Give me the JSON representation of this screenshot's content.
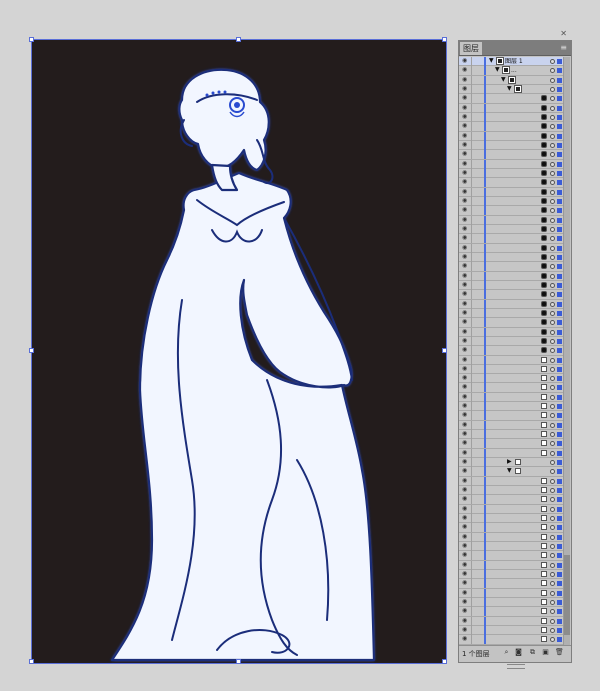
{
  "panel": {
    "tab_label": "图层",
    "menu_icon": "panel-menu-icon",
    "close_icon": "close-icon",
    "top_layer": {
      "name": "图层 1"
    },
    "footer": {
      "layer_count": "1 个图层"
    },
    "footer_icons": [
      "locate-object-icon",
      "make-clipping-mask-icon",
      "new-sublayer-icon",
      "new-layer-icon",
      "delete-icon"
    ],
    "rows": [
      {
        "kind": "layer",
        "indent": 0,
        "arrow": "▼",
        "label": "图层 1",
        "selected": true
      },
      {
        "kind": "group",
        "indent": 1,
        "arrow": "▼",
        "label": "..."
      },
      {
        "kind": "group",
        "indent": 2,
        "arrow": "▼",
        "label": ""
      },
      {
        "kind": "group",
        "indent": 3,
        "arrow": "▼",
        "label": ""
      },
      {
        "kind": "path",
        "indent": 4,
        "thumb": "dark"
      },
      {
        "kind": "path",
        "indent": 4,
        "thumb": "dark"
      },
      {
        "kind": "path",
        "indent": 4,
        "thumb": "dark"
      },
      {
        "kind": "path",
        "indent": 4,
        "thumb": "dark"
      },
      {
        "kind": "path",
        "indent": 4,
        "thumb": "dark"
      },
      {
        "kind": "path",
        "indent": 4,
        "thumb": "dark"
      },
      {
        "kind": "path",
        "indent": 4,
        "thumb": "dark"
      },
      {
        "kind": "path",
        "indent": 4,
        "thumb": "dark"
      },
      {
        "kind": "path",
        "indent": 4,
        "thumb": "dark"
      },
      {
        "kind": "path",
        "indent": 4,
        "thumb": "dark"
      },
      {
        "kind": "path",
        "indent": 4,
        "thumb": "dark"
      },
      {
        "kind": "path",
        "indent": 4,
        "thumb": "dark"
      },
      {
        "kind": "path",
        "indent": 4,
        "thumb": "dark"
      },
      {
        "kind": "path",
        "indent": 4,
        "thumb": "dark"
      },
      {
        "kind": "path",
        "indent": 4,
        "thumb": "dark"
      },
      {
        "kind": "path",
        "indent": 4,
        "thumb": "dark"
      },
      {
        "kind": "path",
        "indent": 4,
        "thumb": "dark"
      },
      {
        "kind": "path",
        "indent": 4,
        "thumb": "dark"
      },
      {
        "kind": "path",
        "indent": 4,
        "thumb": "dark"
      },
      {
        "kind": "path",
        "indent": 4,
        "thumb": "dark"
      },
      {
        "kind": "path",
        "indent": 4,
        "thumb": "dark"
      },
      {
        "kind": "path",
        "indent": 4,
        "thumb": "dark"
      },
      {
        "kind": "path",
        "indent": 4,
        "thumb": "dark"
      },
      {
        "kind": "path",
        "indent": 4,
        "thumb": "dark"
      },
      {
        "kind": "path",
        "indent": 4,
        "thumb": "dark"
      },
      {
        "kind": "path",
        "indent": 4,
        "thumb": "dark"
      },
      {
        "kind": "path",
        "indent": 4,
        "thumb": "dark"
      },
      {
        "kind": "path",
        "indent": 4,
        "thumb": "dark"
      },
      {
        "kind": "path",
        "indent": 4,
        "thumb": "light"
      },
      {
        "kind": "path",
        "indent": 4,
        "thumb": "light"
      },
      {
        "kind": "path",
        "indent": 4,
        "thumb": "light"
      },
      {
        "kind": "path",
        "indent": 4,
        "thumb": "light"
      },
      {
        "kind": "path",
        "indent": 4,
        "thumb": "light"
      },
      {
        "kind": "path",
        "indent": 4,
        "thumb": "light"
      },
      {
        "kind": "path",
        "indent": 4,
        "thumb": "light"
      },
      {
        "kind": "path",
        "indent": 4,
        "thumb": "light"
      },
      {
        "kind": "path",
        "indent": 4,
        "thumb": "light"
      },
      {
        "kind": "path",
        "indent": 4,
        "thumb": "light"
      },
      {
        "kind": "path",
        "indent": 4,
        "thumb": "light"
      },
      {
        "kind": "group",
        "indent": 3,
        "arrow": "▶",
        "thumb": "light"
      },
      {
        "kind": "group",
        "indent": 3,
        "arrow": "▼",
        "thumb": "light"
      },
      {
        "kind": "path",
        "indent": 4,
        "thumb": "light"
      },
      {
        "kind": "path",
        "indent": 4,
        "thumb": "light"
      },
      {
        "kind": "path",
        "indent": 4,
        "thumb": "light"
      },
      {
        "kind": "path",
        "indent": 4,
        "thumb": "light"
      },
      {
        "kind": "path",
        "indent": 4,
        "thumb": "light"
      },
      {
        "kind": "path",
        "indent": 4,
        "thumb": "light"
      },
      {
        "kind": "path",
        "indent": 4,
        "thumb": "light"
      },
      {
        "kind": "path",
        "indent": 4,
        "thumb": "light"
      },
      {
        "kind": "path",
        "indent": 4,
        "thumb": "light"
      },
      {
        "kind": "path",
        "indent": 4,
        "thumb": "light"
      },
      {
        "kind": "path",
        "indent": 4,
        "thumb": "light"
      },
      {
        "kind": "path",
        "indent": 4,
        "thumb": "light"
      },
      {
        "kind": "path",
        "indent": 4,
        "thumb": "light"
      },
      {
        "kind": "path",
        "indent": 4,
        "thumb": "light"
      },
      {
        "kind": "path",
        "indent": 4,
        "thumb": "light"
      },
      {
        "kind": "path",
        "indent": 4,
        "thumb": "light"
      },
      {
        "kind": "path",
        "indent": 4,
        "thumb": "light"
      },
      {
        "kind": "path",
        "indent": 4,
        "thumb": "light"
      }
    ]
  },
  "colors": {
    "canvas_bg": "#d4d4d4",
    "artboard_bg": "#231c1c",
    "figure_fill": "#f2f6ff",
    "figure_stroke": "#1b2d7a",
    "selection": "#5a6fd8",
    "layer_color": "#3a5bd6"
  }
}
